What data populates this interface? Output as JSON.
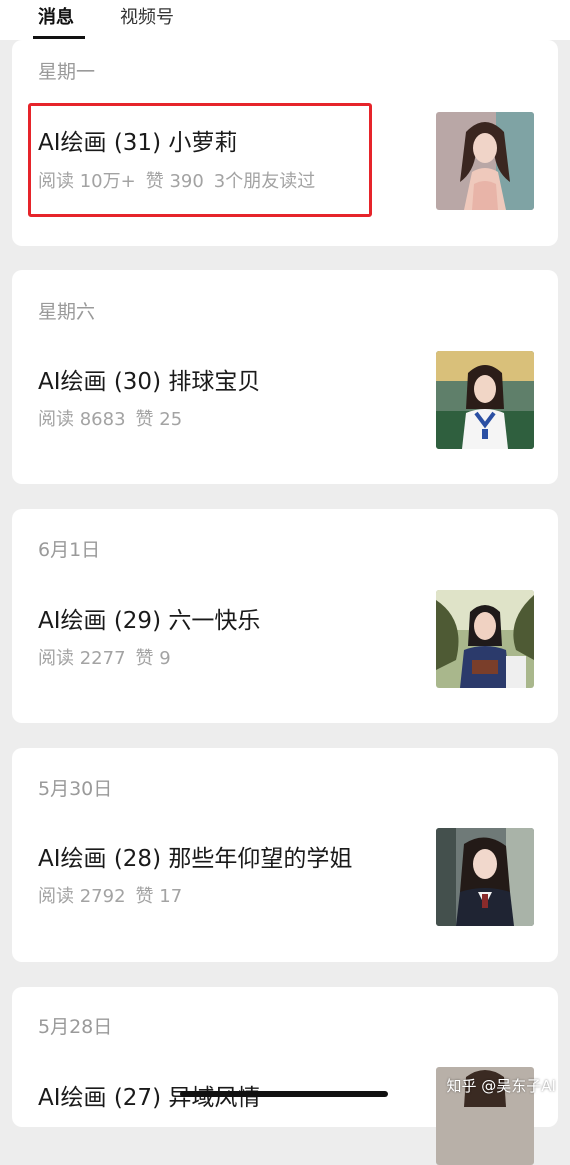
{
  "tabs": [
    {
      "label": "消息"
    },
    {
      "label": "视频号"
    }
  ],
  "articles": [
    {
      "date": "星期一",
      "title": "AI绘画 (31) 小萝莉",
      "reads": "阅读 10万+",
      "likes": "赞 390",
      "friends": "3个朋友读过"
    },
    {
      "date": "星期六",
      "title": "AI绘画 (30) 排球宝贝",
      "reads": "阅读 8683",
      "likes": "赞 25"
    },
    {
      "date": "6月1日",
      "title": "AI绘画 (29) 六一快乐",
      "reads": "阅读 2277",
      "likes": "赞 9"
    },
    {
      "date": "5月30日",
      "title": "AI绘画 (28) 那些年仰望的学姐",
      "reads": "阅读 2792",
      "likes": "赞 17"
    },
    {
      "date": "5月28日",
      "title": "AI绘画 (27) 异域风情"
    }
  ],
  "watermark": "知乎 @吴东子AI",
  "colors": {
    "highlight": "#e6242a",
    "background": "#ededed",
    "card": "#ffffff"
  }
}
